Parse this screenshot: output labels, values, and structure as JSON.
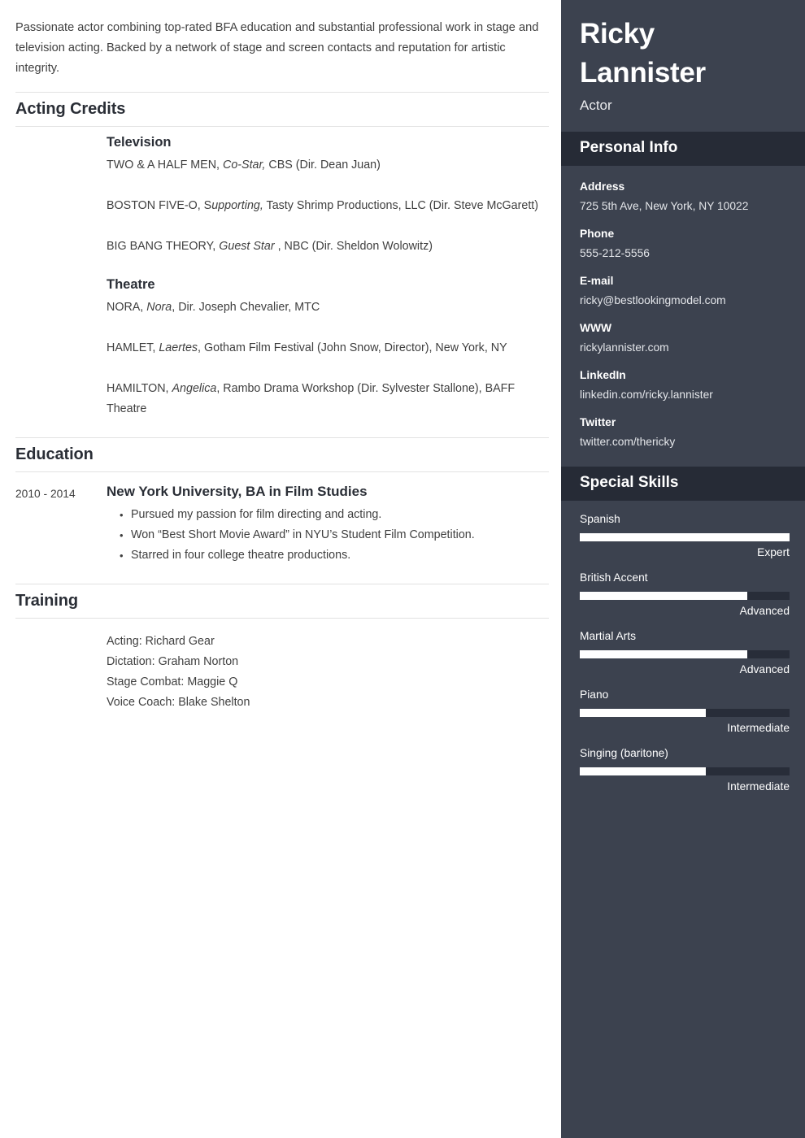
{
  "summary": "Passionate actor combining top-rated BFA education and substantial professional work in stage and television acting. Backed by a network of stage and screen contacts and reputation for artistic integrity.",
  "sections": {
    "acting": {
      "title": "Acting Credits",
      "television": {
        "subtitle": "Television",
        "credits": [
          {
            "show": "TWO & A HALF MEN,",
            "role": " Co-Star,",
            "rest": " CBS (Dir. Dean Juan)"
          },
          {
            "show": "BOSTON FIVE-O, S",
            "role": "upporting,",
            "rest": " Tasty Shrimp Productions, LLC (Dir. Steve McGarett)"
          },
          {
            "show": "BIG BANG THEORY, ",
            "role": "Guest Star",
            "rest": " , NBC (Dir. Sheldon Wolowitz)"
          }
        ]
      },
      "theatre": {
        "subtitle": "Theatre",
        "credits": [
          {
            "show": "NORA, ",
            "role": "Nora",
            "rest": ", Dir. Joseph Chevalier, MTC"
          },
          {
            "show": "HAMLET, ",
            "role": "Laertes",
            "rest": ", Gotham Film Festival (John Snow, Director), New York, NY"
          },
          {
            "show": "HAMILTON, ",
            "role": "Angelica",
            "rest": ", Rambo Drama Workshop (Dir. Sylvester Stallone), BAFF Theatre"
          }
        ]
      }
    },
    "education": {
      "title": "Education",
      "date": "2010 - 2014",
      "degree": "New York University, BA in Film Studies",
      "bullets": [
        "Pursued my passion for film directing and acting.",
        "Won “Best Short Movie Award” in NYU’s Student Film Competition.",
        "Starred in four college theatre productions."
      ]
    },
    "training": {
      "title": "Training",
      "lines": [
        "Acting: Richard Gear",
        "Dictation: Graham Norton",
        "Stage Combat: Maggie Q",
        "Voice Coach: Blake Shelton"
      ]
    }
  },
  "sidebar": {
    "name": "Ricky Lannister",
    "role": "Actor",
    "personal_info": {
      "title": "Personal Info",
      "items": [
        {
          "label": "Address",
          "value": "725 5th Ave, New York, NY 10022"
        },
        {
          "label": "Phone",
          "value": "555-212-5556"
        },
        {
          "label": "E-mail",
          "value": "ricky@bestlookingmodel.com"
        },
        {
          "label": "WWW",
          "value": "rickylannister.com"
        },
        {
          "label": "LinkedIn",
          "value": "linkedin.com/ricky.lannister"
        },
        {
          "label": "Twitter",
          "value": "twitter.com/thericky"
        }
      ]
    },
    "skills": {
      "title": "Special Skills",
      "items": [
        {
          "name": "Spanish",
          "level": "Expert",
          "percent": 100
        },
        {
          "name": "British Accent",
          "level": "Advanced",
          "percent": 80
        },
        {
          "name": "Martial Arts",
          "level": "Advanced",
          "percent": 80
        },
        {
          "name": "Piano",
          "level": "Intermediate",
          "percent": 60
        },
        {
          "name": "Singing (baritone)",
          "level": "Intermediate",
          "percent": 60
        }
      ]
    }
  },
  "colors": {
    "sidebar_bg": "#3c424f",
    "sidebar_header_bg": "#262b36",
    "skill_track": "#282d39",
    "skill_fill": "#ffffff",
    "heading": "#2a2e36",
    "body_text": "#3f3f3f",
    "divider": "#e2e2e2"
  }
}
